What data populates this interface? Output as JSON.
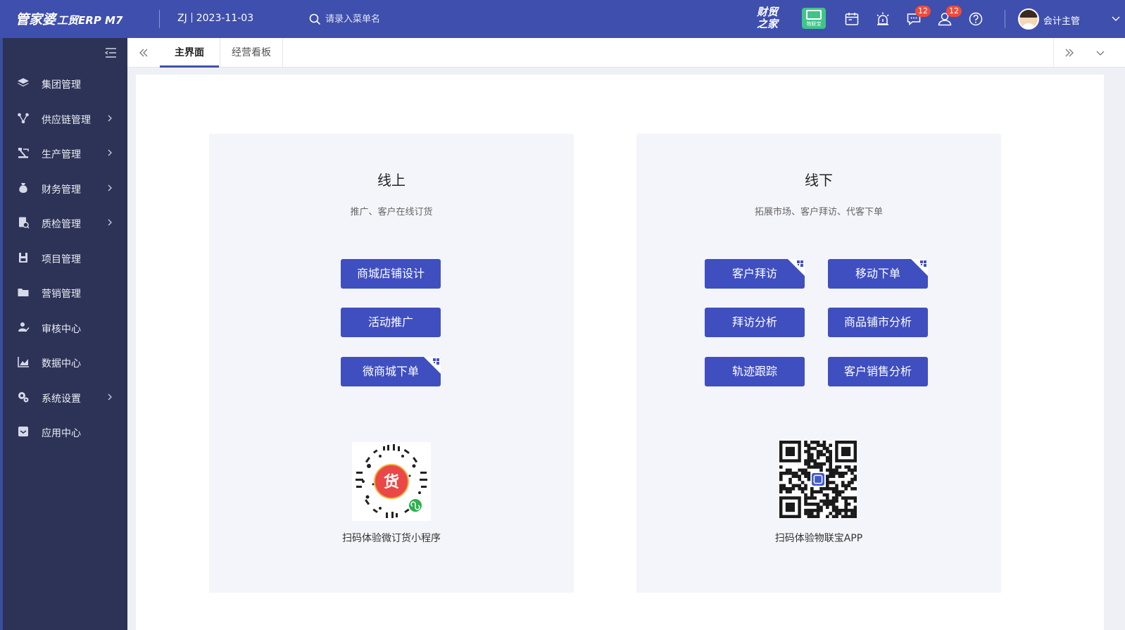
{
  "topbar": {
    "logo_text": "管家婆",
    "logo_suffix": "工贸ERP M7",
    "company_code": "ZJ",
    "date": "2023-11-03",
    "search_placeholder": "请录入菜单名",
    "brand_text": "财贸之家",
    "green_app_text": "物联宝",
    "message_badge": "12",
    "user_badge": "12",
    "username": "会计主管"
  },
  "sidebar": {
    "items": [
      {
        "label": "集团管理",
        "icon": "layers-icon",
        "has_arrow": false
      },
      {
        "label": "供应链管理",
        "icon": "supply-chain-icon",
        "has_arrow": true
      },
      {
        "label": "生产管理",
        "icon": "production-icon",
        "has_arrow": true
      },
      {
        "label": "财务管理",
        "icon": "money-bag-icon",
        "has_arrow": true
      },
      {
        "label": "质检管理",
        "icon": "quality-icon",
        "has_arrow": true
      },
      {
        "label": "项目管理",
        "icon": "save-icon",
        "has_arrow": false
      },
      {
        "label": "营销管理",
        "icon": "folder-icon",
        "has_arrow": false
      },
      {
        "label": "审核中心",
        "icon": "approve-icon",
        "has_arrow": false
      },
      {
        "label": "数据中心",
        "icon": "chart-icon",
        "has_arrow": false
      },
      {
        "label": "系统设置",
        "icon": "settings-icon",
        "has_arrow": true
      },
      {
        "label": "应用中心",
        "icon": "app-icon",
        "has_arrow": false
      }
    ]
  },
  "tabs": {
    "active": "主界面",
    "inactive": "经营看板"
  },
  "online": {
    "title": "线上",
    "subtitle": "推广、客户在线订货",
    "buttons": [
      "商城店铺设计",
      "活动推广",
      "微商城下单"
    ],
    "qr_caption": "扫码体验微订货小程序",
    "qr_logo_text": "货"
  },
  "offline": {
    "title": "线下",
    "subtitle": "拓展市场、客户拜访、代客下单",
    "buttons": [
      "客户拜访",
      "移动下单",
      "拜访分析",
      "商品铺市分析",
      "轨迹跟踪",
      "客户销售分析"
    ],
    "qr_caption": "扫码体验物联宝APP"
  },
  "colors": {
    "topbar": "#3f4fad",
    "sidebar": "#2c3356",
    "button": "#3f4fc0",
    "badge": "#f04a3b",
    "panel": "#f4f5fa"
  }
}
